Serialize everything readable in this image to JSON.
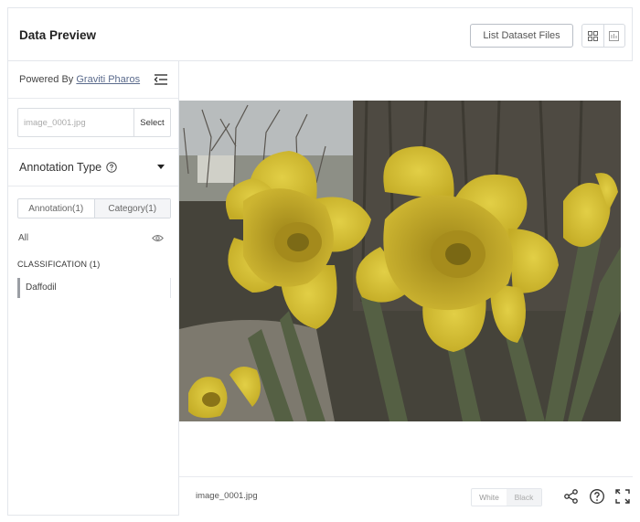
{
  "header": {
    "title": "Data Preview",
    "list_button": "List Dataset Files",
    "grid_view_icon": "grid-view-icon",
    "list_view_icon": "list-view-icon"
  },
  "sidebar": {
    "powered_by": "Powered By",
    "powered_link": "Graviti Pharos",
    "collapse_icon": "collapse-menu-icon",
    "file_input_value": "image_0001.jpg",
    "select_button": "Select",
    "annotation_type_label": "Annotation Type",
    "tabs": [
      {
        "label": "Annotation(1)"
      },
      {
        "label": "Category(1)"
      }
    ],
    "all_label": "All",
    "classification_title": "CLASSIFICATION (1)",
    "classification_items": [
      {
        "label": "Daffodil"
      }
    ]
  },
  "main": {
    "image_alt": "Yellow daffodils in front of a tree trunk",
    "file_name": "image_0001.jpg",
    "bg_options": [
      "White",
      "Black"
    ],
    "footer_icons": [
      "share-icon",
      "help-icon",
      "fullscreen-icon"
    ]
  },
  "colors": {
    "border": "#e3e6eb",
    "link": "#5a6a8c",
    "daffodil_yellow": "#d8c438"
  }
}
